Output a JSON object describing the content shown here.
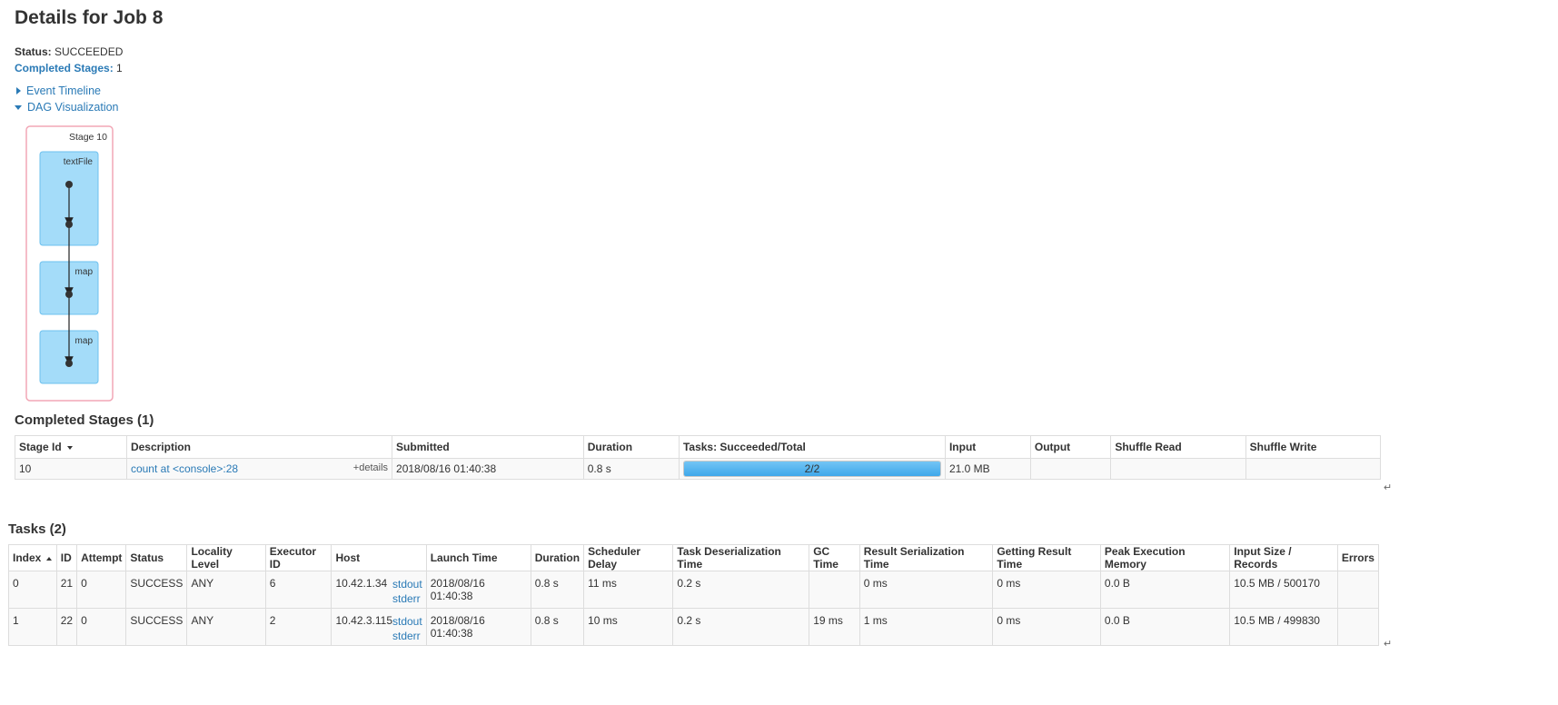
{
  "page": {
    "title": "Details for Job 8"
  },
  "summary": {
    "status_label": "Status:",
    "status_value": "SUCCEEDED",
    "completed_label": "Completed Stages:",
    "completed_value": "1"
  },
  "toggles": {
    "event_timeline": "Event Timeline",
    "dag": "DAG Visualization"
  },
  "dag": {
    "stage_label": "Stage 10",
    "nodes": [
      "textFile",
      "map",
      "map"
    ]
  },
  "stages": {
    "heading": "Completed Stages (1)",
    "columns": [
      "Stage Id",
      "Description",
      "Submitted",
      "Duration",
      "Tasks: Succeeded/Total",
      "Input",
      "Output",
      "Shuffle Read",
      "Shuffle Write"
    ],
    "rows": [
      {
        "stage_id": "10",
        "description": "count at <console>:28",
        "details": "+details",
        "submitted": "2018/08/16 01:40:38",
        "duration": "0.8 s",
        "tasks": "2/2",
        "tasks_fraction": 1.0,
        "input": "21.0 MB",
        "output": "",
        "shuffle_read": "",
        "shuffle_write": ""
      }
    ]
  },
  "tasks": {
    "heading": "Tasks (2)",
    "columns": [
      "Index",
      "ID",
      "Attempt",
      "Status",
      "Locality Level",
      "Executor ID",
      "Host",
      "Launch Time",
      "Duration",
      "Scheduler Delay",
      "Task Deserialization Time",
      "GC Time",
      "Result Serialization Time",
      "Getting Result Time",
      "Peak Execution Memory",
      "Input Size / Records",
      "Errors"
    ],
    "rows": [
      {
        "index": "0",
        "id": "21",
        "attempt": "0",
        "status": "SUCCESS",
        "locality": "ANY",
        "executor": "6",
        "host": "10.42.1.34",
        "stdout": "stdout",
        "stderr": "stderr",
        "launch": "2018/08/16 01:40:38",
        "duration": "0.8 s",
        "sched_delay": "11 ms",
        "deser": "0.2 s",
        "gc": "",
        "result_ser": "0 ms",
        "getting": "0 ms",
        "peak_mem": "0.0 B",
        "input": "10.5 MB / 500170",
        "errors": ""
      },
      {
        "index": "1",
        "id": "22",
        "attempt": "0",
        "status": "SUCCESS",
        "locality": "ANY",
        "executor": "2",
        "host": "10.42.3.115",
        "stdout": "stdout",
        "stderr": "stderr",
        "launch": "2018/08/16 01:40:38",
        "duration": "0.8 s",
        "sched_delay": "10 ms",
        "deser": "0.2 s",
        "gc": "19 ms",
        "result_ser": "1 ms",
        "getting": "0 ms",
        "peak_mem": "0.0 B",
        "input": "10.5 MB / 499830",
        "errors": ""
      }
    ]
  },
  "colors": {
    "link": "#2a7ab6",
    "stage_border": "#f2a7b6",
    "node_fill": "#a4dcf9",
    "node_border": "#6cc0ee",
    "progress_fill": "#3ea7ea"
  },
  "icons": [
    "expand-right-icon",
    "collapse-down-icon",
    "sort-desc-icon",
    "sort-asc-icon",
    "return-mark-icon"
  ]
}
